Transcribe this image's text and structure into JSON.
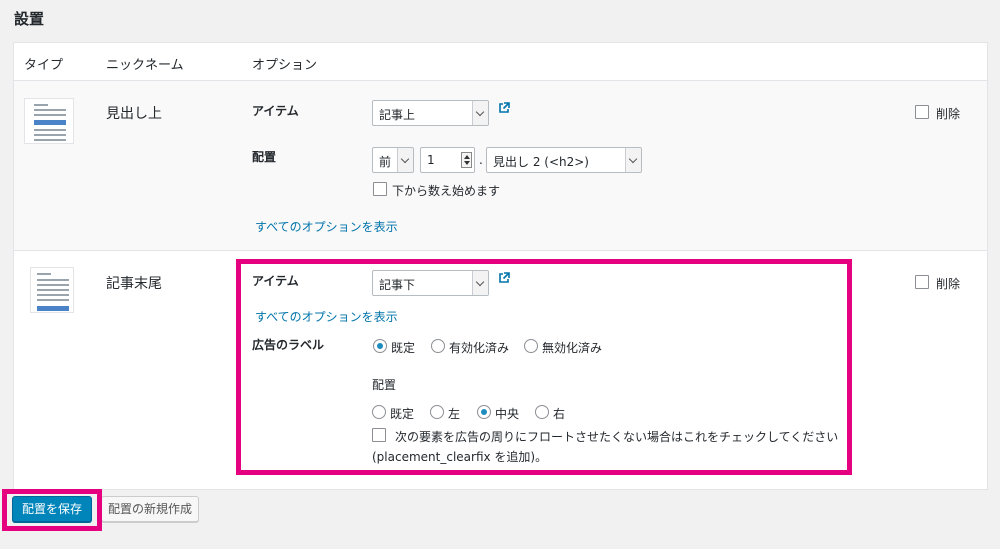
{
  "section_title": "設置",
  "table": {
    "headers": {
      "type": "タイプ",
      "nickname": "ニックネーム",
      "options": "オプション"
    }
  },
  "rows": [
    {
      "nickname": "見出し上",
      "item_label": "アイテム",
      "item_value": "記事上",
      "placement_label": "配置",
      "position_select": "前",
      "number_value": "1",
      "dot": ".",
      "heading_select": "見出し 2 (<h2>)",
      "count_from_bottom": "下から数え始めます",
      "show_all_options": "すべてのオプションを表示",
      "delete_label": "削除"
    },
    {
      "nickname": "記事末尾",
      "item_label": "アイテム",
      "item_value": "記事下",
      "show_all_options": "すべてのオプションを表示",
      "ad_label_title": "広告のラベル",
      "ad_label_options": [
        "既定",
        "有効化済み",
        "無効化済み"
      ],
      "ad_label_selected": "既定",
      "align_title": "配置",
      "align_options": [
        "既定",
        "左",
        "中央",
        "右"
      ],
      "align_selected": "中央",
      "clearfix_text": "次の要素を広告の周りにフロートさせたくない場合はこれをチェックしてください",
      "clearfix_note": "(placement_clearfix を追加)。",
      "delete_label": "削除"
    }
  ],
  "buttons": {
    "save": "配置を保存",
    "new_placement": "配置の新規作成"
  },
  "colors": {
    "highlight": "#e4007f",
    "primary_button": "#0085ba",
    "link": "#0073aa"
  }
}
